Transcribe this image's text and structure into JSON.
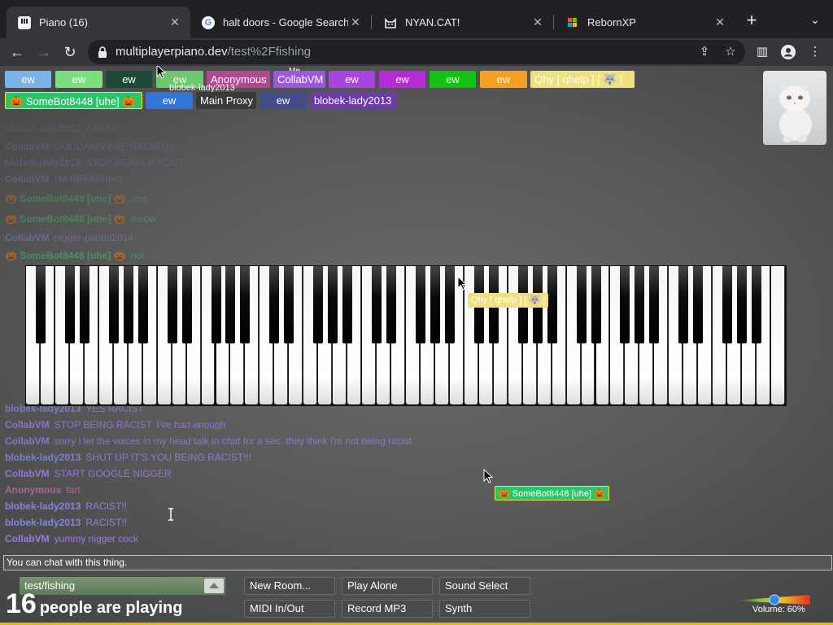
{
  "browser": {
    "tabs": [
      {
        "title": "Piano (16)",
        "active": true,
        "icon": "piano-favicon"
      },
      {
        "title": "halt doors - Google Search",
        "active": false,
        "icon": "google-favicon"
      },
      {
        "title": "NYAN.CAT!",
        "active": false,
        "icon": "cat-favicon"
      },
      {
        "title": "RebornXP",
        "active": false,
        "icon": "windows-favicon"
      }
    ],
    "url_domain": "multiplayerpiano.dev",
    "url_path": "/test%2Ffishing"
  },
  "users": {
    "row1": [
      "ew",
      "ew",
      "ew",
      "ew",
      "Anonymous",
      "CollabVM",
      "ew",
      "ew",
      "ew",
      "ew",
      "Qhy [ qhelp ] [ 🐺 ]"
    ],
    "row2": [
      "🎃 SomeBot8448 [uhe] 🎃",
      "ew",
      "Main Proxy",
      "ew",
      "blobek-lady2013"
    ],
    "me_label": "Me",
    "hover_name": "blobek-lady2013",
    "colors": [
      "#7ab3e8",
      "#7be07b",
      "#1c4a36",
      "#6ec66e",
      "#b04a8e",
      "#9b59e0",
      "#a844e0",
      "#b62ad8",
      "#14c214",
      "#f5a020",
      "#f0e080",
      "#2ac46a",
      "#3474d6",
      "#3a3a3a",
      "#444c8a",
      "#6a3aa8"
    ]
  },
  "chat": [
    {
      "who": "blobek-lady2013",
      "text": "ĀĀĀĀĀ",
      "color": "#8a8af0"
    },
    {
      "who": "CollabVM",
      "text": "GODDAMN ARE RACIST!!!",
      "color": "#a07cf0"
    },
    {
      "who": "blobek-lady2013",
      "text": "STOP BEING RACIST!",
      "color": "#8a8af0"
    },
    {
      "who": "CollabVM",
      "text": "I'M REPAIRING",
      "color": "#a07cf0"
    },
    {
      "who": "🎃 SomeBot8448 [uhe] 🎃",
      "text": "uhe",
      "color": "#3fd47a"
    },
    {
      "who": "🎃 SomeBot8448 [uhe] 🎃",
      "text": "meow",
      "color": "#3fd47a"
    },
    {
      "who": "CollabVM",
      "text": "nigger-panda2014",
      "color": "#a07cf0"
    },
    {
      "who": "🎃 SomeBot8448 [uhe] 🎃",
      "text": "no\\",
      "color": "#3fd47a"
    },
    {
      "who": "blobek-lady2013",
      "text": "YES RACIST",
      "color": "#8a8af0"
    },
    {
      "who": "CollabVM",
      "text": "STOP BEING RACIST. I've had enough",
      "color": "#a07cf0"
    },
    {
      "who": "CollabVM",
      "text": "sorry i let the voices in my head talk in chat for a sec. they think i'm not being racist",
      "color": "#a07cf0"
    },
    {
      "who": "blobek-lady2013",
      "text": "SHUT UP IT'S YOU BEING RACIST!!!",
      "color": "#8a8af0"
    },
    {
      "who": "CollabVM",
      "text": "START GOOGLE NIGGER",
      "color": "#a07cf0"
    },
    {
      "who": "Anonymous",
      "text": "fart",
      "color": "#b86aa0"
    },
    {
      "who": "blobek-lady2013",
      "text": "RACIST!!",
      "color": "#8a8af0"
    },
    {
      "who": "blobek-lady2013",
      "text": "RACIST!!",
      "color": "#8a8af0"
    },
    {
      "who": "CollabVM",
      "text": "yummy nigger cock",
      "color": "#a07cf0"
    }
  ],
  "cursor_tags": {
    "qhy": "Qhy [ qhelp ] [ 🐺 ]",
    "somebot": "🎃 SomeBot8448 [uhe] 🎃"
  },
  "chat_input_placeholder": "You can chat with this thing.",
  "room": "test/fishing",
  "player_count": "16",
  "player_count_text": "people are playing",
  "buttons": {
    "new_room": "New Room...",
    "play_alone": "Play Alone",
    "sound_select": "Sound Select",
    "midi": "MIDI In/Out",
    "record": "Record MP3",
    "synth": "Synth"
  },
  "volume_label": "Volume: 60%",
  "volume_level": 0.6
}
